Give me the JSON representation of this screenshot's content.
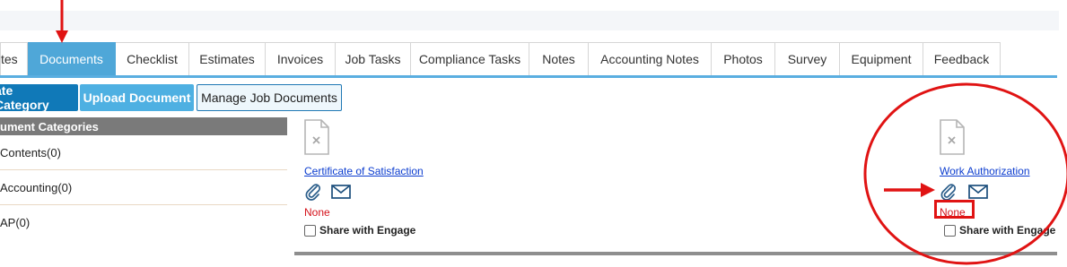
{
  "tabs": [
    {
      "label": "tes",
      "active": false
    },
    {
      "label": "Documents",
      "active": true
    },
    {
      "label": "Checklist",
      "active": false
    },
    {
      "label": "Estimates",
      "active": false
    },
    {
      "label": "Invoices",
      "active": false
    },
    {
      "label": "Job Tasks",
      "active": false
    },
    {
      "label": "Compliance Tasks",
      "active": false
    },
    {
      "label": "Notes",
      "active": false
    },
    {
      "label": "Accounting Notes",
      "active": false
    },
    {
      "label": "Photos",
      "active": false
    },
    {
      "label": "Survey",
      "active": false
    },
    {
      "label": "Equipment",
      "active": false
    },
    {
      "label": "Feedback",
      "active": false
    }
  ],
  "buttons": {
    "create_category": "ate Category",
    "upload_document": "Upload Document",
    "manage_job_documents": "Manage Job Documents"
  },
  "categories": {
    "heading": "ument Categories",
    "items": [
      "Contents(0)",
      "Accounting(0)",
      "AP(0)"
    ]
  },
  "documents": [
    {
      "name": "Certificate of Satisfaction",
      "status": "None",
      "share_label": "Share with Engage",
      "shared": false
    },
    {
      "name": "Work Authorization",
      "status": "None",
      "share_label": "Share with Engage",
      "shared": false
    }
  ],
  "colors": {
    "active_tab": "#4fa7d8",
    "primary_button": "#1079b8",
    "annotation_red": "#e01313",
    "status_red": "#d4111a"
  }
}
